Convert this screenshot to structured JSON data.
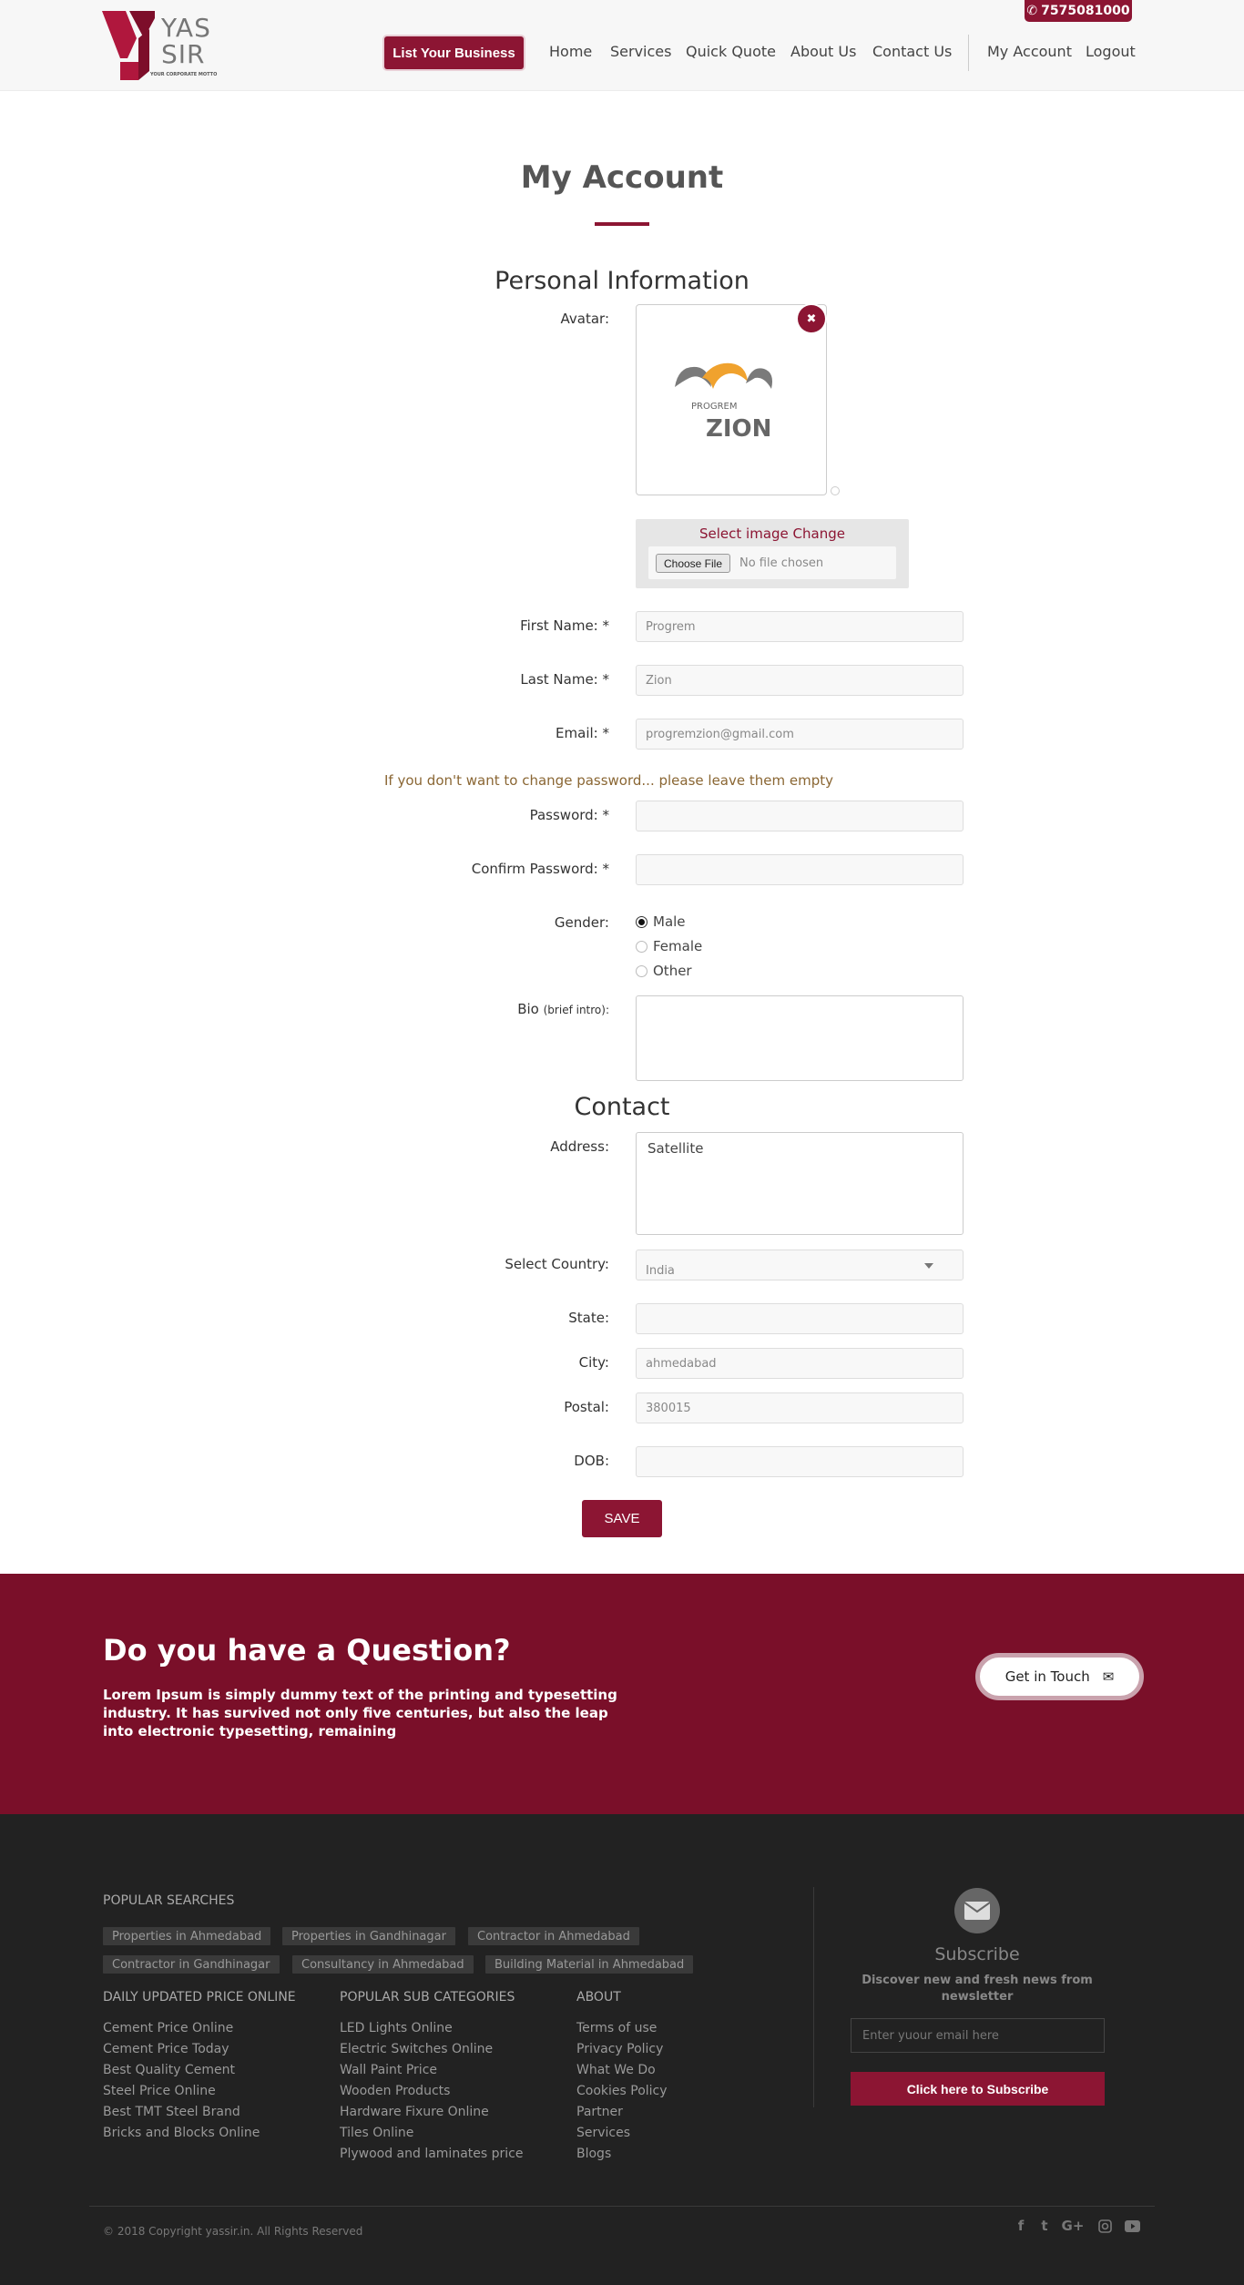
{
  "header": {
    "phone": "7575081000",
    "logo_text_1": "YAS",
    "logo_text_2": "SIR",
    "logo_tagline": "YOUR CORPORATE MOTTO",
    "list_business": "List Your Business",
    "nav": [
      "Home",
      "Services",
      "Quick Quote",
      "About Us",
      "Contact Us",
      "My Account",
      "Logout"
    ]
  },
  "main": {
    "title": "My Account",
    "personal_heading": "Personal Information",
    "avatar_label": "Avatar:",
    "avatar_logo_small": "PROGREM",
    "avatar_logo_big": "ZION",
    "file_caption": "Select image Change",
    "file_button": "Choose File",
    "file_none": "No file chosen",
    "first_name_label": "First Name: *",
    "first_name_value": "Progrem",
    "last_name_label": "Last Name: *",
    "last_name_value": "Zion",
    "email_label": "Email: *",
    "email_value": "progremzion@gmail.com",
    "password_note": "If you don't want to change password... please leave them empty",
    "password_label": "Password: *",
    "confirm_password_label": "Confirm Password: *",
    "gender_label": "Gender:",
    "gender_options": [
      "Male",
      "Female",
      "Other"
    ],
    "gender_selected": "Male",
    "bio_label": "Bio",
    "bio_hint": "(brief intro):",
    "contact_heading": "Contact",
    "address_label": "Address:",
    "address_value": "Satellite",
    "country_label": "Select Country:",
    "country_value": "India",
    "state_label": "State:",
    "city_label": "City:",
    "city_value": "ahmedabad",
    "postal_label": "Postal:",
    "postal_value": "380015",
    "dob_label": "DOB:",
    "save": "SAVE"
  },
  "banner": {
    "title": "Do you have a Question?",
    "text": "Lorem Ipsum is simply dummy text of the printing and typesetting industry. It has survived not only five centuries, but also the leap into electronic typesetting, remaining",
    "button": "Get in Touch"
  },
  "footer": {
    "popular_heading": "POPULAR SEARCHES",
    "tags": [
      "Properties in Ahmedabad",
      "Properties in Gandhinagar",
      "Contractor in Ahmedabad",
      "Contractor in Gandhinagar",
      "Consultancy in Ahmedabad",
      "Building Material in Ahmedabad"
    ],
    "col1_heading": "DAILY UPDATED PRICE ONLINE",
    "col1": [
      "Cement Price Online",
      "Cement Price Today",
      "Best Quality Cement",
      "Steel Price Online",
      "Best TMT Steel Brand",
      "Bricks and Blocks Online"
    ],
    "col2_heading": "POPULAR SUB CATEGORIES",
    "col2": [
      "LED Lights Online",
      "Electric Switches Online",
      "Wall Paint Price",
      "Wooden Products",
      "Hardware Fixure Online",
      "Tiles Online",
      "Plywood and laminates price"
    ],
    "col3_heading": "ABOUT",
    "col3": [
      "Terms of use",
      "Privacy Policy",
      "What We Do",
      "Cookies Policy",
      "Partner",
      "Services",
      "Blogs"
    ],
    "subscribe_title": "Subscribe",
    "subscribe_text": "Discover new and fresh news from newsletter",
    "subscribe_placeholder": "Enter yuour email here",
    "subscribe_button": "Click here to Subscribe",
    "copyright": "© 2018 Copyright yassir.in. All Rights Reserved",
    "social_icons": [
      "facebook-icon",
      "twitter-icon",
      "google-plus-icon",
      "instagram-icon",
      "youtube-icon"
    ]
  },
  "colors": {
    "brand": "#8c1533",
    "banner": "#7a0f29",
    "footer": "#222222"
  }
}
